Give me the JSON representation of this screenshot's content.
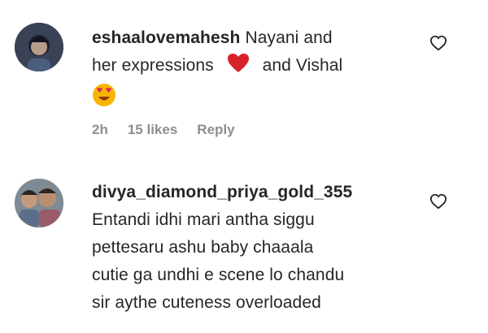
{
  "comments": [
    {
      "username": "eshaalovemahesh",
      "text_line1": "Nayani and",
      "text_line2_a": "her expressions",
      "text_line2_b": "and Vishal",
      "time": "2h",
      "likes": "15 likes",
      "reply": "Reply",
      "emojis": [
        "red-heart",
        "heart-eyes-face"
      ]
    },
    {
      "username": "divya_diamond_priya_gold_355",
      "lines": [
        "Entandi idhi mari antha siggu",
        "pettesaru ashu baby chaaala",
        "cutie ga undhi e scene lo chandu",
        "sir aythe cuteness overloaded"
      ]
    }
  ],
  "colors": {
    "text": "#262626",
    "meta": "#8e8e8e",
    "heart_emoji": "#e0245e"
  }
}
